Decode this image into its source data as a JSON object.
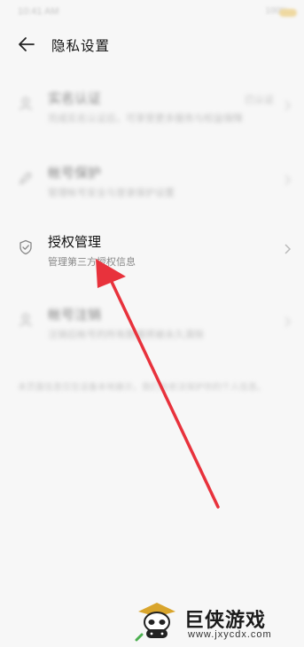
{
  "status_bar": {
    "time": "10:41 AM",
    "right": "100%"
  },
  "header": {
    "title": "隐私设置"
  },
  "rows": [
    {
      "title": "实名认证",
      "subtitle": "完成实名认证后，可享受更多服务与权益保障",
      "right_text": "已认证"
    },
    {
      "title": "帐号保护",
      "subtitle": "管理帐号安全与登录保护设置"
    },
    {
      "title": "授权管理",
      "subtitle": "管理第三方授权信息"
    },
    {
      "title": "帐号注销",
      "subtitle": "注销后帐号的所有数据将被永久清除"
    }
  ],
  "note": "本页面信息仅在设备本地展示，我们会依法保护你的个人信息。",
  "watermark": {
    "title": "巨侠游戏",
    "url": "www.jxycdx.com"
  },
  "colors": {
    "arrow": "#e8323c",
    "background": "#f7f7f7"
  },
  "icons": {
    "back": "back-arrow-icon",
    "realname": "person-icon",
    "protect": "edit-icon",
    "auth": "shield-check-icon",
    "cancel": "person-icon",
    "chevron": "chevron-right-icon"
  }
}
